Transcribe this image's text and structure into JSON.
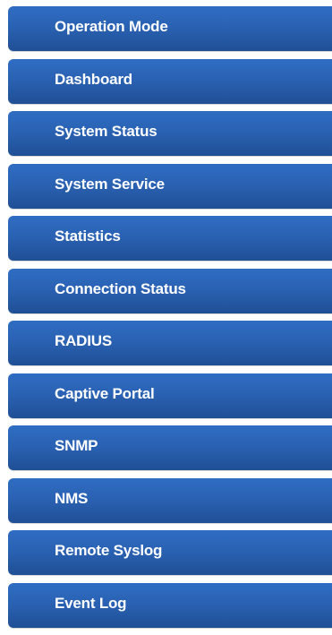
{
  "menu": {
    "items": [
      {
        "label": "Operation Mode"
      },
      {
        "label": "Dashboard"
      },
      {
        "label": "System Status"
      },
      {
        "label": "System Service"
      },
      {
        "label": "Statistics"
      },
      {
        "label": "Connection Status"
      },
      {
        "label": "RADIUS"
      },
      {
        "label": "Captive Portal"
      },
      {
        "label": "SNMP"
      },
      {
        "label": "NMS"
      },
      {
        "label": "Remote Syslog"
      },
      {
        "label": "Event Log"
      }
    ]
  },
  "colors": {
    "item_background": "#2a62b3",
    "item_text": "#ffffff",
    "page_background": "#ffffff"
  }
}
